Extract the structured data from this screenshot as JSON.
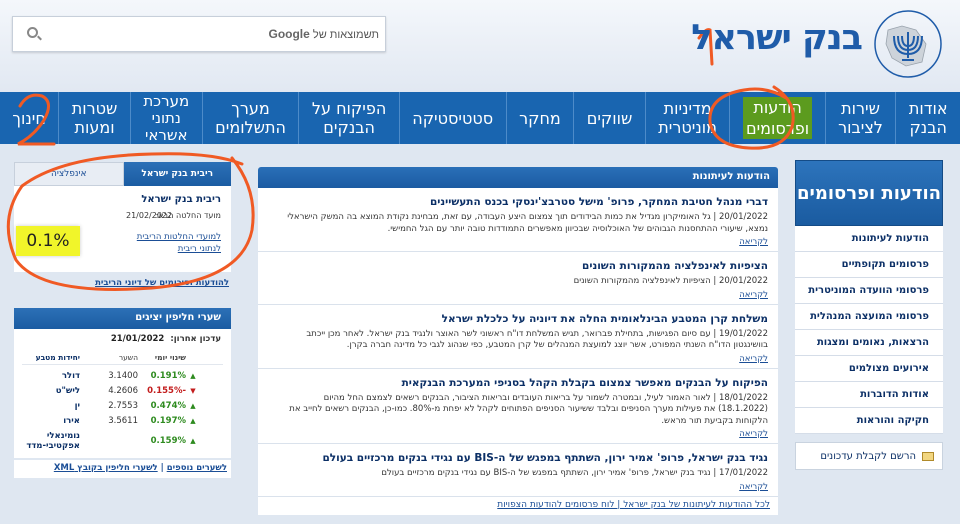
{
  "header": {
    "search_brand": "Google",
    "search_brand_suffix": "תשמוצאות של",
    "site_title": "בנק ישראל",
    "emblem_caption": "BANK OF ISRAEL",
    "emblem_caption_he": "בנק ישראל"
  },
  "nav": {
    "items": [
      {
        "id": "about",
        "line1": "אודות",
        "line2": "הבנק"
      },
      {
        "id": "public",
        "line1": "שירות",
        "line2": "לציבור"
      },
      {
        "id": "news",
        "line1": "הודעות",
        "line2": "ופרסומים"
      },
      {
        "id": "policy",
        "line1": "מדיניות",
        "line2": "מוניטרית"
      },
      {
        "id": "markets",
        "line1": "שווקים",
        "line2": ""
      },
      {
        "id": "research",
        "line1": "מחקר",
        "line2": ""
      },
      {
        "id": "statistics",
        "line1": "סטטיסטיקה",
        "line2": ""
      },
      {
        "id": "supervision",
        "line1": "הפיקוח על",
        "line2": "הבנקים"
      },
      {
        "id": "payments",
        "line1": "מערך",
        "line2": "התשלומים"
      },
      {
        "id": "credit",
        "line1": "מערכת",
        "line2": "נתוני",
        "line3": "אשראי"
      },
      {
        "id": "currency",
        "line1": "שטרות",
        "line2": "ומעות"
      },
      {
        "id": "education",
        "line1": "חינוך",
        "line2": ""
      }
    ]
  },
  "side_right": {
    "header": "הודעות ופרסומים",
    "items": [
      "הודעות לעיתונות",
      "פרסומים תקופתיים",
      "פרסומי הוועדה המוניטרית",
      "פרסומי המועצה המנהלית",
      "הרצאות, נאומים ומצגות",
      "אירועים מצולמים",
      "אודות הדוברות",
      "חקיקה והוראות"
    ],
    "subscribe": "הרשם לקבלת עדכונים"
  },
  "main": {
    "header": "הודעות לעיתונות",
    "read_more": "לקריאה",
    "news": [
      {
        "title": "דברי מנהל חטיבת המחקר, פרופ' מישל סטרבצ'ינסקי בכנס התעשיינים",
        "date": "20/01/2022",
        "body": "גל האומיקרון מגדיל את כמות הבידודים תוך צמצום היצע העבודה, עם זאת, מבחינת נקודת המוצא בה המשק הישראלי נמצא, שיעורי ההתחסנות הגבוהים של האוכלוסיה שבכיוון מאפשרים התמודדות טובה יותר עם הגל החמישי."
      },
      {
        "title": "הציפיות לאינפלציה מהמקורות השונים",
        "date": "20/01/2022",
        "body": "הציפיות לאינפלציה מהמקורות השונים"
      },
      {
        "title": "משלחת קרן המטבע הבינלאומית החלה את דיוניה על כלכלת ישראל",
        "date": "19/01/2022",
        "body": "עם סיום הפגישות, בתחילת פברואר, תגיש המשלחת דו\"ח ראשוני לשר האוצר ולנגיד בנק ישראל. לאחר מכן ייכתב בוושינגטון הדו\"ח השנתי המפורט, אשר יוצג למועצת המנהלים של קרן המטבע, כפי שנהוג לגבי כל מדינה חברה בקרן."
      },
      {
        "title": "הפיקוח על הבנקים מאפשר צמצום בקבלת הקהל בסניפי המערכת הבנקאית",
        "date": "18/01/2022",
        "body": "לאור האמור לעיל, ובמטרה לשמור על בריאות העובדים ובריאות הציבור, הבנקים רשאים לצמצם החל מהיום (18.1.2022) את פעילות מערך הסניפים ובלבד ששיעור הסניפים הפתוחים לקהל לא יפחת מ-80%. כמו-כן, הבנקים רשאים לחייב את הלקוחות בקביעת תור מראש."
      },
      {
        "title": "נגיד בנק ישראל, פרופ' אמיר ירון, השתתף במפגש של ה-BIS עם נגידי בנקים מרכזיים בעולם",
        "date": "17/01/2022",
        "body": "נגיד בנק ישראל, פרופ' אמיר ירון, השתתף במפגש של ה-BIS עם נגידי בנקים מרכזיים בעולם"
      }
    ],
    "footer": "לכל ההודעות לעיתונות של בנק ישראל | לוח פרסומים להודעות הצפויות"
  },
  "left": {
    "tabs": {
      "active": "ריבית בנק ישראל",
      "inactive": "אינפלציה"
    },
    "rate_title": "ריבית בנק ישראל",
    "rate_date_label": "מועד החלטה הבא:",
    "rate_date": "21/02/2022",
    "rate_value": "0.1%",
    "link_decisions": "למועדי החלטות הריבית",
    "link_data": "לנתוני ריבית",
    "footer_link": "להודעות וסיכומים של דיוני הריבית",
    "fx": {
      "header": "שערי חליפין יציגים",
      "updated_label": "עדכון אחרון:",
      "updated": "21/01/2022",
      "col_unit": "יחידות מטבע",
      "col_rate": "השער",
      "col_change": "שינוי יומי",
      "rows": [
        {
          "unit": "דולר",
          "rate": "3.1400",
          "change": "0.191%",
          "dir": "up"
        },
        {
          "unit": "ליש\"ט",
          "rate": "4.2606",
          "change": "-0.155%",
          "dir": "down"
        },
        {
          "unit": "ין",
          "rate": "2.7553",
          "change": "0.474%",
          "dir": "up"
        },
        {
          "unit": "אירו",
          "rate": "3.5611",
          "change": "0.197%",
          "dir": "up"
        },
        {
          "unit": "נומינאלי אפקטיבי-מדד",
          "rate": "",
          "change": "0.159%",
          "dir": "up"
        }
      ],
      "link_more": "לשערים נוספים",
      "link_xml": "לשערי חליפין בקובץ XML"
    }
  },
  "colors": {
    "nav_blue": "#1965b0",
    "title_blue": "#1f5ca9",
    "highlight_green": "#5c9b1e",
    "rate_yellow": "#f1f52a",
    "annotation_orange": "#f05a24"
  }
}
